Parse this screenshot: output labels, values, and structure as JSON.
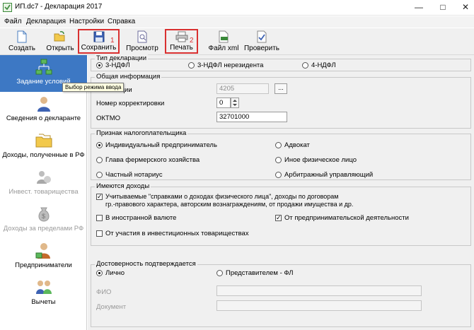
{
  "window": {
    "title": "ИП.dc7 - Декларация 2017"
  },
  "menu": {
    "items": [
      "Файл",
      "Декларация",
      "Настройки",
      "Справка"
    ]
  },
  "toolbar": {
    "create": "Создать",
    "open": "Открыть",
    "save": "Сохранить",
    "preview": "Просмотр",
    "print": "Печать",
    "xml": "Файл xml",
    "check": "Проверить",
    "marker_1": "1",
    "marker_2": "2",
    "highlight_color": "#d93030"
  },
  "nav": {
    "items": [
      {
        "label": "Задание условий",
        "state": "active"
      },
      {
        "label": "Сведения о декларанте",
        "state": "enabled"
      },
      {
        "label": "Доходы, полученные в РФ",
        "state": "enabled"
      },
      {
        "label": "Инвест. товарищества",
        "state": "disabled"
      },
      {
        "label": "Доходы за пределами РФ",
        "state": "disabled"
      },
      {
        "label": "Предприниматели",
        "state": "enabled"
      },
      {
        "label": "Вычеты",
        "state": "enabled"
      }
    ],
    "active_color": "#3d78c4"
  },
  "tooltip": "Выбор режима ввода",
  "decl_type": {
    "title": "Тип декларации",
    "options": [
      "3-НДФЛ",
      "3-НДФЛ нерезидента",
      "4-НДФЛ"
    ],
    "selected": "3-НДФЛ"
  },
  "general": {
    "title": "Общая информация",
    "inspection_label": "Номер инспекции",
    "inspection_visible": "нспекции",
    "inspection_value": "4205",
    "browse_label": "...",
    "correction_label": "Номер корректировки",
    "correction_value": "0",
    "oktmo_label": "ОКТМО",
    "oktmo_value": "32701000"
  },
  "taxpayer": {
    "title": "Признак налогоплательщика",
    "options": [
      "Индивидуальный предприниматель",
      "Адвокат",
      "Глава фермерского хозяйства",
      "Иное физическое лицо",
      "Частный нотариус",
      "Арбитражный управляющий"
    ],
    "selected": "Индивидуальный предприниматель"
  },
  "income": {
    "title": "Имеются доходы",
    "cb_reports_line1": "Учитываемые \"справками о доходах физического лица\", доходы по договорам",
    "cb_reports_line2": "гр.-правового характера, авторским вознаграждениям, от продажи имущества и др.",
    "cb_reports_checked": true,
    "cb_foreign": "В иностранной валюте",
    "cb_foreign_checked": false,
    "cb_business": "От предпринимательской деятельности",
    "cb_business_checked": true,
    "cb_investment": "От участия в инвестиционных товариществах",
    "cb_investment_checked": false
  },
  "reliability": {
    "title": "Достоверность подтверждается",
    "opt_personal": "Лично",
    "opt_rep": "Представителем - ФЛ",
    "selected": "Лично",
    "fio_label": "ФИО",
    "fio_value": "",
    "doc_label": "Документ",
    "doc_value": ""
  }
}
